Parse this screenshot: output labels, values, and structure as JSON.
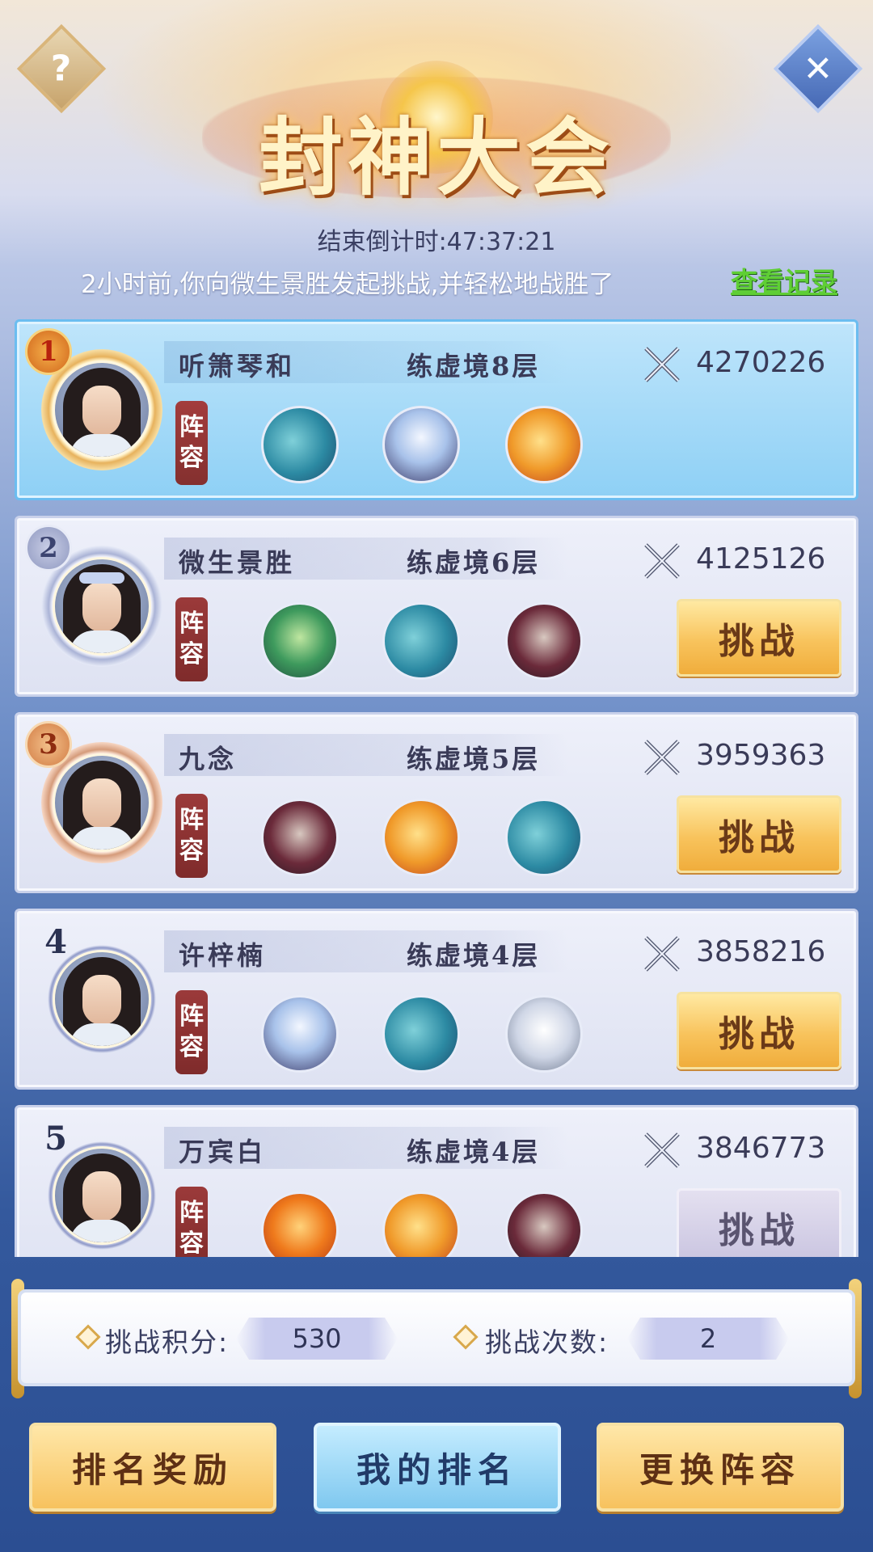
{
  "header": {
    "title": "封神大会",
    "help_icon": "question-mark-icon",
    "close_icon": "close-x-icon",
    "help_glyph": "?",
    "close_glyph": "✕"
  },
  "countdown": {
    "label": "结束倒计时:47:37:21"
  },
  "battle_log": {
    "message": "2小时前,你向微生景胜发起挑战,并轻松地战胜了",
    "link_label": "查看记录"
  },
  "lineup_label": [
    "阵",
    "容"
  ],
  "players": [
    {
      "rank": "1",
      "name": "听箫琴和",
      "realm": "练虚境8层",
      "power": "4270226",
      "beasts": [
        "whale-spirit-icon",
        "azure-dragon-icon",
        "fire-dragon-icon"
      ],
      "challenge_label": ""
    },
    {
      "rank": "2",
      "name": "微生景胜",
      "realm": "练虚境6层",
      "power": "4125126",
      "beasts": [
        "green-dragon-icon",
        "whale-spirit-icon",
        "dark-beast-icon"
      ],
      "challenge_label": "挑战"
    },
    {
      "rank": "3",
      "name": "九念",
      "realm": "练虚境5层",
      "power": "3959363",
      "beasts": [
        "dark-beast-icon",
        "fire-dragon-icon",
        "whale-spirit-icon"
      ],
      "challenge_label": "挑战"
    },
    {
      "rank": "4",
      "name": "许梓楠",
      "realm": "练虚境4层",
      "power": "3858216",
      "beasts": [
        "azure-dragon-icon",
        "whale-spirit-icon",
        "white-tiger-icon"
      ],
      "challenge_label": "挑战"
    },
    {
      "rank": "5",
      "name": "万宾白",
      "realm": "练虚境4层",
      "power": "3846773",
      "beasts": [
        "phoenix-icon",
        "fire-dragon-icon",
        "dark-beast-icon"
      ],
      "challenge_label": "挑战"
    }
  ],
  "stats": {
    "points_label": "挑战积分:",
    "points_value": "530",
    "attempts_label": "挑战次数:",
    "attempts_value": "2"
  },
  "bottom_buttons": {
    "ranking_rewards": "排名奖励",
    "my_ranking": "我的排名",
    "change_lineup": "更换阵容"
  },
  "colors": {
    "link_green": "#5fce35",
    "challenge_gold": "#f8c35c",
    "first_card_blue": "#8ed0f5"
  }
}
